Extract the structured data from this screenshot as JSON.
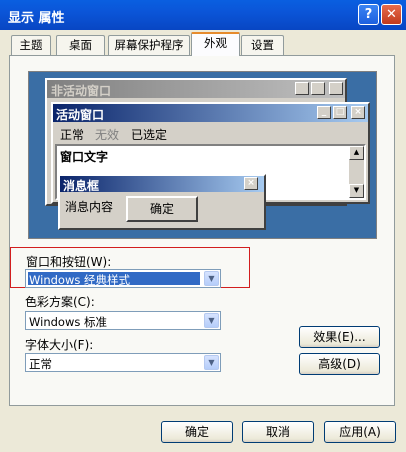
{
  "window": {
    "title": "显示 属性",
    "help_label": "?",
    "close_label": "✕"
  },
  "tabs": [
    {
      "label": "主题"
    },
    {
      "label": "桌面"
    },
    {
      "label": "屏幕保护程序"
    },
    {
      "label": "外观"
    },
    {
      "label": "设置"
    }
  ],
  "active_tab": "外观",
  "preview": {
    "inactive_title": "非活动窗口",
    "active_title": "活动窗口",
    "menu_items": [
      "正常",
      "无效",
      "已选定"
    ],
    "window_text": "窗口文字",
    "msgbox_title": "消息框",
    "msgbox_content": "消息内容",
    "ok_label": "确定"
  },
  "fields": {
    "windows_buttons": {
      "label": "窗口和按钮(W):",
      "value": "Windows 经典样式"
    },
    "color_scheme": {
      "label": "色彩方案(C):",
      "value": "Windows 标准"
    },
    "font_size": {
      "label": "字体大小(F):",
      "value": "正常"
    }
  },
  "buttons": {
    "effects": "效果(E)...",
    "advanced": "高级(D)",
    "ok": "确定",
    "cancel": "取消",
    "apply": "应用(A)"
  },
  "colors": {
    "titlebar": "#0a5fe0",
    "highlight_box": "#d21e1e",
    "preview_bg": "#3a6ea5",
    "active_title": "#0a246a"
  }
}
